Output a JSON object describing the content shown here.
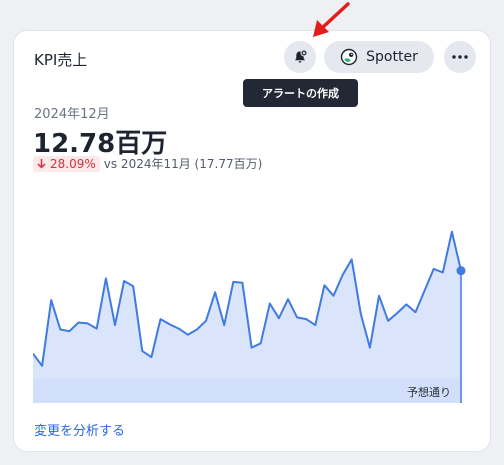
{
  "card": {
    "title": "KPI売上",
    "period": "2024年12月",
    "value": "12.78百万",
    "change": {
      "direction_icon": "arrow-down-icon",
      "percent": "28.09%",
      "comparison": "vs 2024年11月 (17.77百万)"
    },
    "footer_link": "変更を分析する"
  },
  "header_actions": {
    "alert_icon": "bell-plus-icon",
    "spotter_icon": "spotter-icon",
    "spotter_label": "Spotter",
    "more_icon": "more-horizontal-icon"
  },
  "tooltip": {
    "text": "アラートの作成"
  },
  "chart_data": {
    "type": "area",
    "values": [
      5.7,
      4.3,
      11.9,
      8.5,
      8.3,
      9.3,
      9.2,
      8.6,
      14.4,
      9.0,
      14.1,
      13.5,
      6.0,
      5.3,
      9.7,
      9.1,
      8.6,
      7.9,
      8.5,
      9.5,
      12.8,
      9.0,
      14.0,
      13.9,
      6.4,
      6.9,
      11.5,
      9.8,
      12.0,
      9.9,
      9.7,
      9.0,
      13.6,
      12.4,
      14.8,
      16.6,
      10.3,
      6.4,
      12.4,
      9.5,
      10.4,
      11.4,
      10.5,
      13.0,
      15.5,
      15.1,
      19.8,
      15.3
    ],
    "annotation": "予想通り",
    "colors": {
      "line": "#3f7be0",
      "fill": "#d4e1fa",
      "band": "#c2d5f6"
    }
  },
  "overlay": {
    "arrow_color": "#e31c1c"
  }
}
